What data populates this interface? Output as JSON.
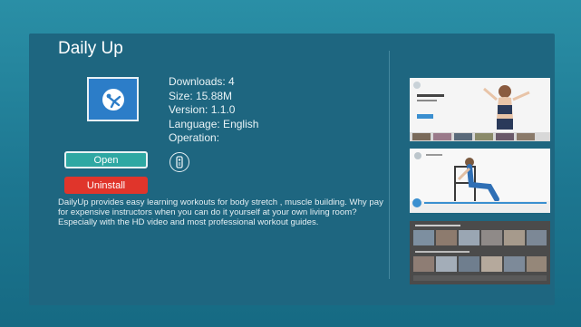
{
  "app": {
    "title": "Daily Up",
    "icon": "yoga-pose-icon",
    "info": {
      "downloads": "Downloads: 4",
      "size": "Size: 15.88M",
      "version": "Version: 1.1.0",
      "language": "Language: English",
      "operation": "Operation:"
    },
    "operation_icon": "remote-control-icon",
    "buttons": {
      "open": "Open",
      "uninstall": "Uninstall"
    },
    "description": "DailyUp provides easy learning workouts for body stretch , muscle building. Why pay for expensive instructors when you can do it yourself at your own living room? Especially with the HD video and most professional workout guides."
  },
  "colors": {
    "background": "#1d7791",
    "panel": "#1e6680",
    "open_button": "#2ea8a3",
    "uninstall_button": "#e0352b",
    "icon_bg": "#2c7dc8"
  },
  "screenshots": [
    "screenshot-workout-home",
    "screenshot-chair-dip",
    "screenshot-workout-grid"
  ]
}
